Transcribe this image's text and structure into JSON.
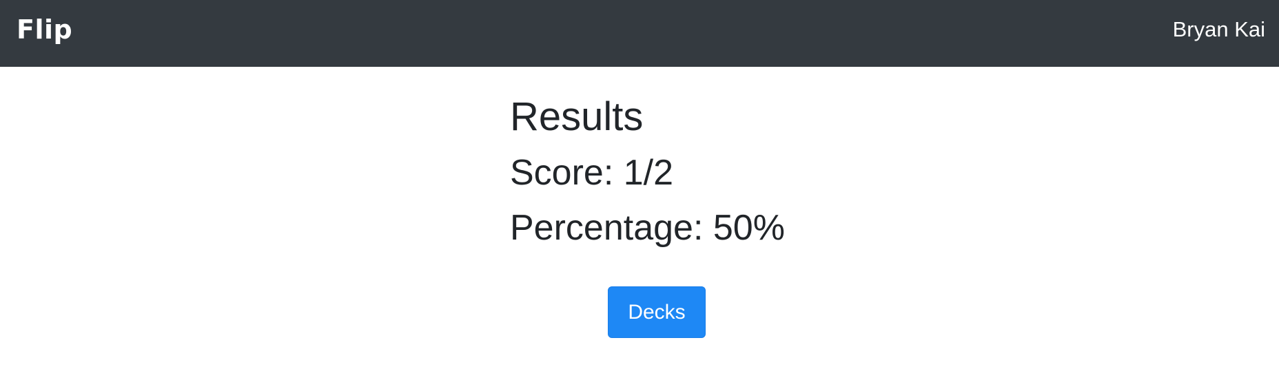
{
  "navbar": {
    "brand": "Flip",
    "user_name": "Bryan Kai",
    "background_color": "#343a40"
  },
  "results": {
    "title": "Results",
    "score_label": "Score:",
    "score_value": "1/2",
    "percentage_label": "Percentage:",
    "percentage_value": "50%"
  },
  "actions": {
    "decks_label": "Decks",
    "button_color": "#1e88f5"
  }
}
